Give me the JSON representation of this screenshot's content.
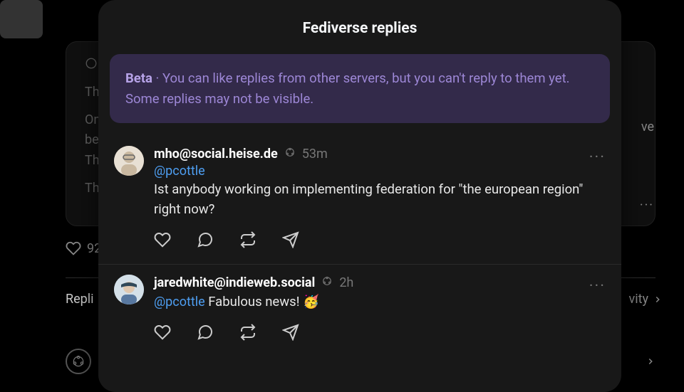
{
  "modal": {
    "title": "Fediverse replies",
    "banner": {
      "label": "Beta",
      "sep": " · ",
      "text": "You can like replies from other servers, but you can't reply to them yet. Some replies may not be visible."
    },
    "replies": [
      {
        "author": "mho@social.heise.de",
        "time": "53m",
        "mention": "@pcottle",
        "body": "Ist anybody working on implementing federation for \"the european region\" right now?"
      },
      {
        "author": "jaredwhite@indieweb.social",
        "time": "2h",
        "mention": "@pcottle",
        "body_inline": " Fabulous news! 🥳"
      }
    ]
  },
  "background": {
    "line1": "Th",
    "line2": "On",
    "line3": "be",
    "line4": "Th",
    "line5": "Th",
    "right_ve": "ve",
    "likes": "92",
    "repl": "Repli",
    "vity": "vity"
  }
}
